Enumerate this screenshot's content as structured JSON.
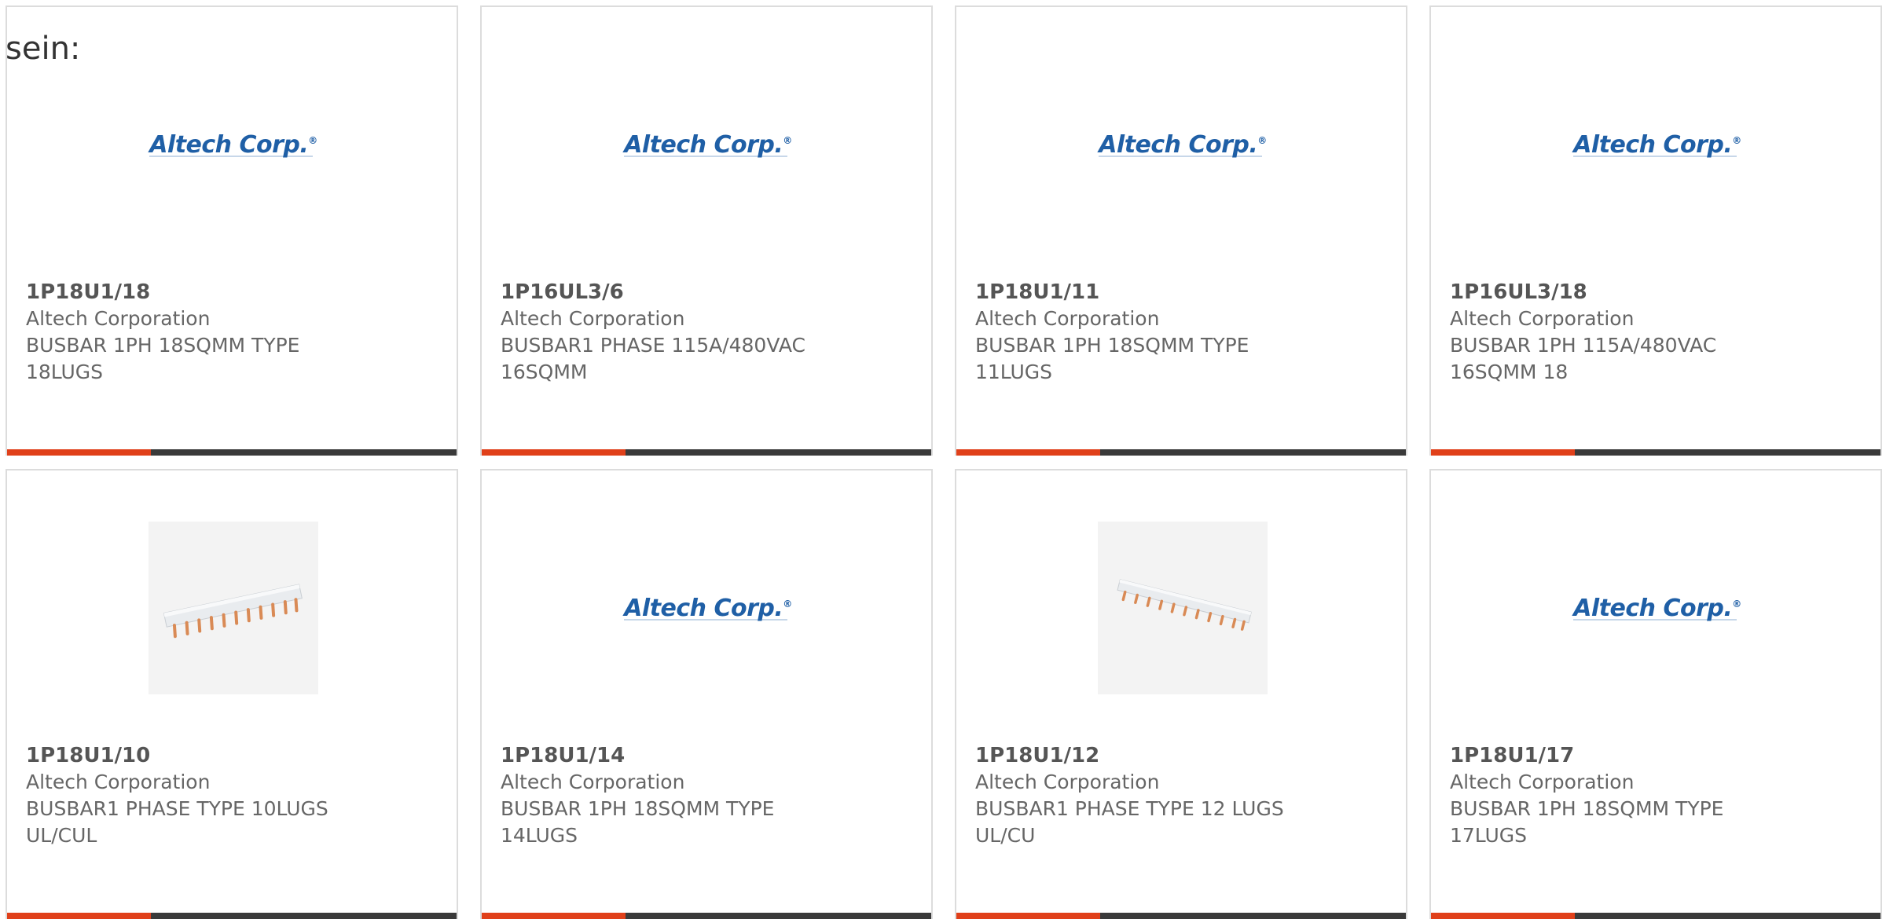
{
  "intro_text": "sein:",
  "logo": {
    "text": "Altech Corp.",
    "mark": "®"
  },
  "colors": {
    "accent_bar": "#e0401a",
    "dark_bar": "#3a3a3a",
    "logo_blue": "#1f5fa6"
  },
  "products": [
    {
      "part": "1P18U1/18",
      "maker": "Altech Corporation",
      "desc_line1": "BUSBAR 1PH 18SQMM TYPE",
      "desc_line2": "18LUGS",
      "image": "altech-logo"
    },
    {
      "part": "1P16UL3/6",
      "maker": "Altech Corporation",
      "desc_line1": "BUSBAR1 PHASE 115A/480VAC",
      "desc_line2": "16SQMM",
      "image": "altech-logo"
    },
    {
      "part": "1P18U1/11",
      "maker": "Altech Corporation",
      "desc_line1": "BUSBAR 1PH 18SQMM TYPE",
      "desc_line2": "11LUGS",
      "image": "altech-logo"
    },
    {
      "part": "1P16UL3/18",
      "maker": "Altech Corporation",
      "desc_line1": "BUSBAR 1PH 115A/480VAC",
      "desc_line2": "16SQMM 18",
      "image": "altech-logo"
    },
    {
      "part": "1P18U1/10",
      "maker": "Altech Corporation",
      "desc_line1": "BUSBAR1 PHASE TYPE 10LUGS",
      "desc_line2": "UL/CUL",
      "image": "busbar-photo"
    },
    {
      "part": "1P18U1/14",
      "maker": "Altech Corporation",
      "desc_line1": "BUSBAR 1PH 18SQMM TYPE",
      "desc_line2": "14LUGS",
      "image": "altech-logo"
    },
    {
      "part": "1P18U1/12",
      "maker": "Altech Corporation",
      "desc_line1": "BUSBAR1 PHASE TYPE 12 LUGS",
      "desc_line2": "UL/CU",
      "image": "busbar-photo"
    },
    {
      "part": "1P18U1/17",
      "maker": "Altech Corporation",
      "desc_line1": "BUSBAR 1PH 18SQMM TYPE",
      "desc_line2": "17LUGS",
      "image": "altech-logo"
    }
  ]
}
